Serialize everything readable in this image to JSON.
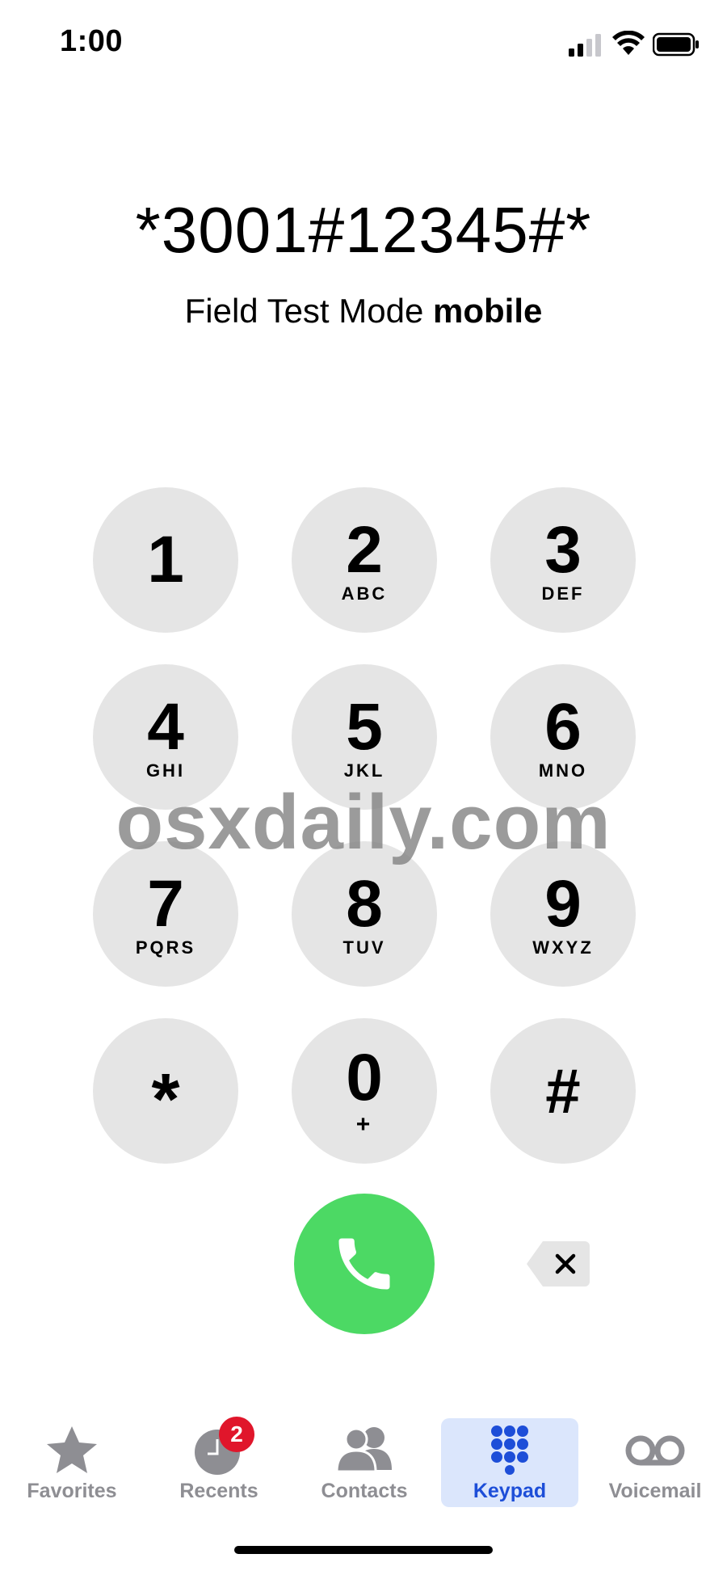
{
  "status_bar": {
    "time": "1:00"
  },
  "dialer": {
    "number": "*3001#12345#*",
    "caller_name": "Field Test Mode",
    "caller_label": "mobile"
  },
  "keypad": {
    "keys": [
      {
        "digit": "1",
        "letters": ""
      },
      {
        "digit": "2",
        "letters": "ABC"
      },
      {
        "digit": "3",
        "letters": "DEF"
      },
      {
        "digit": "4",
        "letters": "GHI"
      },
      {
        "digit": "5",
        "letters": "JKL"
      },
      {
        "digit": "6",
        "letters": "MNO"
      },
      {
        "digit": "7",
        "letters": "PQRS"
      },
      {
        "digit": "8",
        "letters": "TUV"
      },
      {
        "digit": "9",
        "letters": "WXYZ"
      },
      {
        "digit": "*",
        "letters": ""
      },
      {
        "digit": "0",
        "letters": "+"
      },
      {
        "digit": "#",
        "letters": ""
      }
    ]
  },
  "watermark": "osxdaily.com",
  "colors": {
    "call_green": "#4cd964",
    "key_gray": "#e5e5e5",
    "active_tab_blue": "#1d4ed8",
    "badge_red": "#e0162b"
  },
  "tab_bar": {
    "favorites": {
      "label": "Favorites",
      "icon": "star-icon"
    },
    "recents": {
      "label": "Recents",
      "icon": "clock-icon",
      "badge": "2"
    },
    "contacts": {
      "label": "Contacts",
      "icon": "people-icon"
    },
    "keypad": {
      "label": "Keypad",
      "icon": "keypad-grid-icon",
      "active": true
    },
    "voicemail": {
      "label": "Voicemail",
      "icon": "voicemail-icon"
    }
  }
}
